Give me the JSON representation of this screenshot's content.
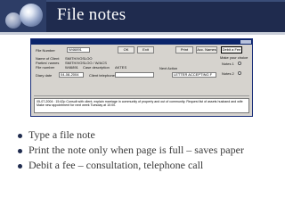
{
  "slide": {
    "title": "File notes"
  },
  "app": {
    "buttons": {
      "ok": "OK",
      "exit": "Exit",
      "print": "Print",
      "acc_names": "Acc. Names",
      "debit_fee": "Debit a Fee"
    },
    "labels": {
      "file_number": "File Number",
      "name_of_client": "Name of Client",
      "parties_names": "Parties' names",
      "file_number_lower": "File number",
      "case_description": "Case description",
      "diary_date": "Diary date",
      "client_telephone": "Client telephone",
      "next_action": "Next Action",
      "make_choice": "Make your choice",
      "notes_1": "Notes 1",
      "notes_2": "Notes 2"
    },
    "values": {
      "file_number": "W46891",
      "client_name": "SMITH/VOSLOO",
      "parties": "SMITH/VOSLOO   /  W/ACS",
      "file_no": "W46891",
      "case_desc": "AKTES",
      "diary_date": "04-08-2004",
      "next_action": "LETTER ACCEPTING F"
    },
    "notes": [
      "05-07-2004 : 15:42p Consult with client, explain marriage in community of property and out of community. Request list of assets husband and wife",
      "Make new appointment for next week Tuesday at 10:00."
    ]
  },
  "bullets": [
    "Type a file note",
    "Print the note only when page is full – saves paper",
    "Debit a fee – consultation, telephone call"
  ],
  "colors": {
    "title_bar": "#1f2b4e",
    "bullet_text": "#3a3a3a",
    "window_face": "#d6d3ce"
  }
}
